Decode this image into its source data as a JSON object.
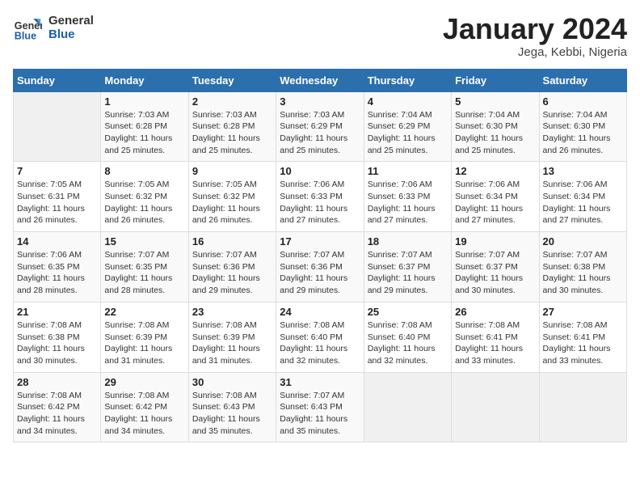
{
  "header": {
    "logo_line1": "General",
    "logo_line2": "Blue",
    "title": "January 2024",
    "subtitle": "Jega, Kebbi, Nigeria"
  },
  "weekdays": [
    "Sunday",
    "Monday",
    "Tuesday",
    "Wednesday",
    "Thursday",
    "Friday",
    "Saturday"
  ],
  "weeks": [
    [
      {
        "day": "",
        "info": ""
      },
      {
        "day": "1",
        "info": "Sunrise: 7:03 AM\nSunset: 6:28 PM\nDaylight: 11 hours\nand 25 minutes."
      },
      {
        "day": "2",
        "info": "Sunrise: 7:03 AM\nSunset: 6:28 PM\nDaylight: 11 hours\nand 25 minutes."
      },
      {
        "day": "3",
        "info": "Sunrise: 7:03 AM\nSunset: 6:29 PM\nDaylight: 11 hours\nand 25 minutes."
      },
      {
        "day": "4",
        "info": "Sunrise: 7:04 AM\nSunset: 6:29 PM\nDaylight: 11 hours\nand 25 minutes."
      },
      {
        "day": "5",
        "info": "Sunrise: 7:04 AM\nSunset: 6:30 PM\nDaylight: 11 hours\nand 25 minutes."
      },
      {
        "day": "6",
        "info": "Sunrise: 7:04 AM\nSunset: 6:30 PM\nDaylight: 11 hours\nand 26 minutes."
      }
    ],
    [
      {
        "day": "7",
        "info": "Sunrise: 7:05 AM\nSunset: 6:31 PM\nDaylight: 11 hours\nand 26 minutes."
      },
      {
        "day": "8",
        "info": "Sunrise: 7:05 AM\nSunset: 6:32 PM\nDaylight: 11 hours\nand 26 minutes."
      },
      {
        "day": "9",
        "info": "Sunrise: 7:05 AM\nSunset: 6:32 PM\nDaylight: 11 hours\nand 26 minutes."
      },
      {
        "day": "10",
        "info": "Sunrise: 7:06 AM\nSunset: 6:33 PM\nDaylight: 11 hours\nand 27 minutes."
      },
      {
        "day": "11",
        "info": "Sunrise: 7:06 AM\nSunset: 6:33 PM\nDaylight: 11 hours\nand 27 minutes."
      },
      {
        "day": "12",
        "info": "Sunrise: 7:06 AM\nSunset: 6:34 PM\nDaylight: 11 hours\nand 27 minutes."
      },
      {
        "day": "13",
        "info": "Sunrise: 7:06 AM\nSunset: 6:34 PM\nDaylight: 11 hours\nand 27 minutes."
      }
    ],
    [
      {
        "day": "14",
        "info": "Sunrise: 7:06 AM\nSunset: 6:35 PM\nDaylight: 11 hours\nand 28 minutes."
      },
      {
        "day": "15",
        "info": "Sunrise: 7:07 AM\nSunset: 6:35 PM\nDaylight: 11 hours\nand 28 minutes."
      },
      {
        "day": "16",
        "info": "Sunrise: 7:07 AM\nSunset: 6:36 PM\nDaylight: 11 hours\nand 29 minutes."
      },
      {
        "day": "17",
        "info": "Sunrise: 7:07 AM\nSunset: 6:36 PM\nDaylight: 11 hours\nand 29 minutes."
      },
      {
        "day": "18",
        "info": "Sunrise: 7:07 AM\nSunset: 6:37 PM\nDaylight: 11 hours\nand 29 minutes."
      },
      {
        "day": "19",
        "info": "Sunrise: 7:07 AM\nSunset: 6:37 PM\nDaylight: 11 hours\nand 30 minutes."
      },
      {
        "day": "20",
        "info": "Sunrise: 7:07 AM\nSunset: 6:38 PM\nDaylight: 11 hours\nand 30 minutes."
      }
    ],
    [
      {
        "day": "21",
        "info": "Sunrise: 7:08 AM\nSunset: 6:38 PM\nDaylight: 11 hours\nand 30 minutes."
      },
      {
        "day": "22",
        "info": "Sunrise: 7:08 AM\nSunset: 6:39 PM\nDaylight: 11 hours\nand 31 minutes."
      },
      {
        "day": "23",
        "info": "Sunrise: 7:08 AM\nSunset: 6:39 PM\nDaylight: 11 hours\nand 31 minutes."
      },
      {
        "day": "24",
        "info": "Sunrise: 7:08 AM\nSunset: 6:40 PM\nDaylight: 11 hours\nand 32 minutes."
      },
      {
        "day": "25",
        "info": "Sunrise: 7:08 AM\nSunset: 6:40 PM\nDaylight: 11 hours\nand 32 minutes."
      },
      {
        "day": "26",
        "info": "Sunrise: 7:08 AM\nSunset: 6:41 PM\nDaylight: 11 hours\nand 33 minutes."
      },
      {
        "day": "27",
        "info": "Sunrise: 7:08 AM\nSunset: 6:41 PM\nDaylight: 11 hours\nand 33 minutes."
      }
    ],
    [
      {
        "day": "28",
        "info": "Sunrise: 7:08 AM\nSunset: 6:42 PM\nDaylight: 11 hours\nand 34 minutes."
      },
      {
        "day": "29",
        "info": "Sunrise: 7:08 AM\nSunset: 6:42 PM\nDaylight: 11 hours\nand 34 minutes."
      },
      {
        "day": "30",
        "info": "Sunrise: 7:08 AM\nSunset: 6:43 PM\nDaylight: 11 hours\nand 35 minutes."
      },
      {
        "day": "31",
        "info": "Sunrise: 7:07 AM\nSunset: 6:43 PM\nDaylight: 11 hours\nand 35 minutes."
      },
      {
        "day": "",
        "info": ""
      },
      {
        "day": "",
        "info": ""
      },
      {
        "day": "",
        "info": ""
      }
    ]
  ]
}
